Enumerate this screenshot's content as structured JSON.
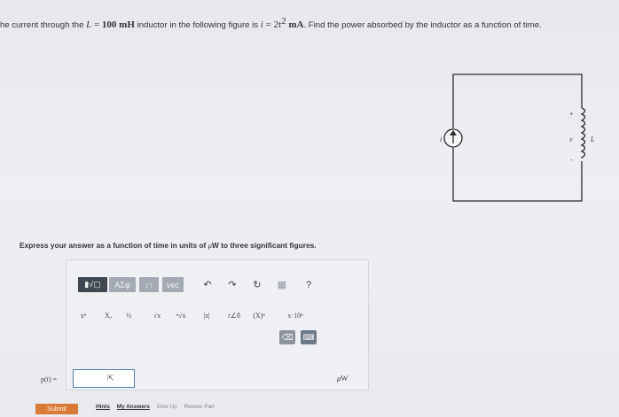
{
  "question": {
    "prefix": "he current through the ",
    "L_symbol": "L",
    "eq1": " = ",
    "L_value": "100 mH",
    "mid": " inductor in the following figure is ",
    "i_symbol": "i",
    "eq2": " = ",
    "i_coef": "2t",
    "i_exp": "2",
    "i_unit": " mA",
    "suffix": ". Find the power absorbed by the inductor as a function of time."
  },
  "circuit": {
    "current_label": "i",
    "plus_label": "+",
    "voltage_label": "v",
    "inductor_label": "L",
    "minus_label": "-"
  },
  "instruction": {
    "text_before": "Express your answer as a function of time in units of ",
    "unit_mu": "μ",
    "unit_w": "W",
    "text_after": " to three significant figures."
  },
  "toolbar": {
    "templates_label": "▮√▢",
    "greek_label": "ΑΣφ",
    "arrows_label": "↕↑",
    "vec_label": "vec",
    "undo_icon": "↶",
    "redo_icon": "↷",
    "reset_icon": "↻",
    "keyboard_icon": "▦",
    "help_label": "?"
  },
  "symbols": {
    "power": "xⁿ",
    "subscript": "Xₐ",
    "fraction": "½",
    "sqrt": "√x",
    "nthroot": "ⁿ√x",
    "abs": "|x|",
    "polar": "r∠θ",
    "paren": "(X)ⁿ",
    "sci": "x·10ⁿ"
  },
  "keys": {
    "delete_icon": "⌫",
    "keyboard2_icon": "⌨"
  },
  "answer": {
    "label": "p(t) =",
    "value": "",
    "unit_mu": "μ",
    "unit_w": "W"
  },
  "actions": {
    "submit": "Submit",
    "hints": "Hints",
    "my_answers": "My Answers",
    "give_up": "Give Up",
    "review_part": "Review Part"
  },
  "colors": {
    "submit": "#d97b36",
    "answer_border": "#4f7ea8",
    "toolbar_button": "#a4aab3"
  }
}
